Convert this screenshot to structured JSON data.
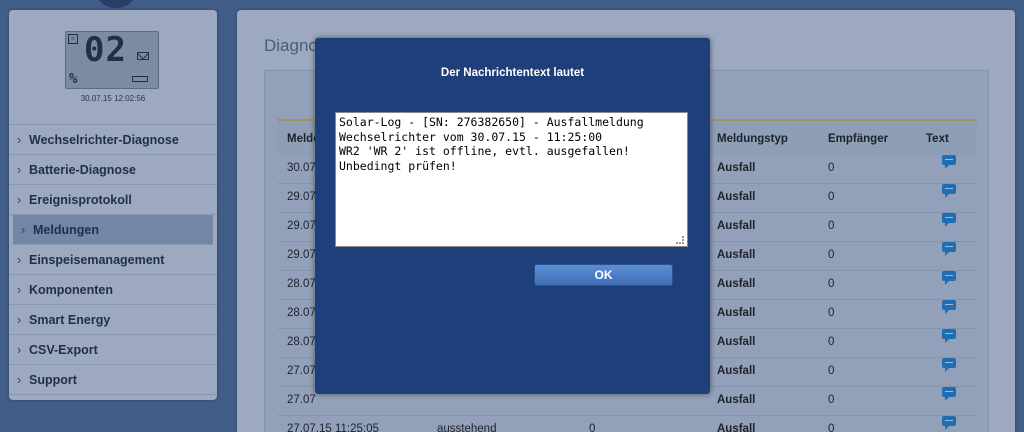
{
  "sidebar": {
    "lcd": {
      "digits": "02",
      "percent": "%",
      "datetime": "30.07.15 12:02:56"
    },
    "items": [
      {
        "label": "Wechselrichter-Diagnose"
      },
      {
        "label": "Batterie-Diagnose"
      },
      {
        "label": "Ereignisprotokoll"
      },
      {
        "label": "Meldungen",
        "active": true
      },
      {
        "label": "Einspeisemanagement"
      },
      {
        "label": "Komponenten"
      },
      {
        "label": "Smart Energy"
      },
      {
        "label": "CSV-Export"
      },
      {
        "label": "Support"
      }
    ]
  },
  "main": {
    "title": "Diagno",
    "table": {
      "columns": {
        "date": "Melde",
        "type": "Meldungstyp",
        "recipient": "Empfänger",
        "text": "Text"
      },
      "rows": [
        {
          "date": "30.07",
          "type": "Ausfall",
          "recipient": "0"
        },
        {
          "date": "29.07",
          "type": "Ausfall",
          "recipient": "0"
        },
        {
          "date": "29.07",
          "type": "Ausfall",
          "recipient": "0"
        },
        {
          "date": "29.07",
          "type": "Ausfall",
          "recipient": "0"
        },
        {
          "date": "28.07",
          "type": "Ausfall",
          "recipient": "0"
        },
        {
          "date": "28.07",
          "type": "Ausfall",
          "recipient": "0"
        },
        {
          "date": "28.07",
          "type": "Ausfall",
          "recipient": "0"
        },
        {
          "date": "27.07",
          "type": "Ausfall",
          "recipient": "0"
        },
        {
          "date": "27.07",
          "type": "Ausfall",
          "recipient": "0"
        },
        {
          "date": "27.07.15 11:25:05",
          "status": "ausstehend",
          "count": "0",
          "type": "Ausfall",
          "recipient": "0"
        }
      ]
    }
  },
  "modal": {
    "title": "Der Nachrichtentext lautet",
    "message": "Solar-Log - [SN: 276382650] - Ausfallmeldung\nWechselrichter vom 30.07.15 - 11:25:00\nWR2 'WR 2' ist offline, evtl. ausgefallen!\nUnbedingt prüfen!",
    "ok_label": "OK"
  },
  "icons": {
    "message": "speech-bubble-icon",
    "menu": "chevron-right-icon"
  },
  "colors": {
    "modal_bg": "#1e3f7a",
    "ok_button": "#4a7cc3",
    "message_icon": "#1d7fd1",
    "header_rule": "#c7b15a"
  }
}
